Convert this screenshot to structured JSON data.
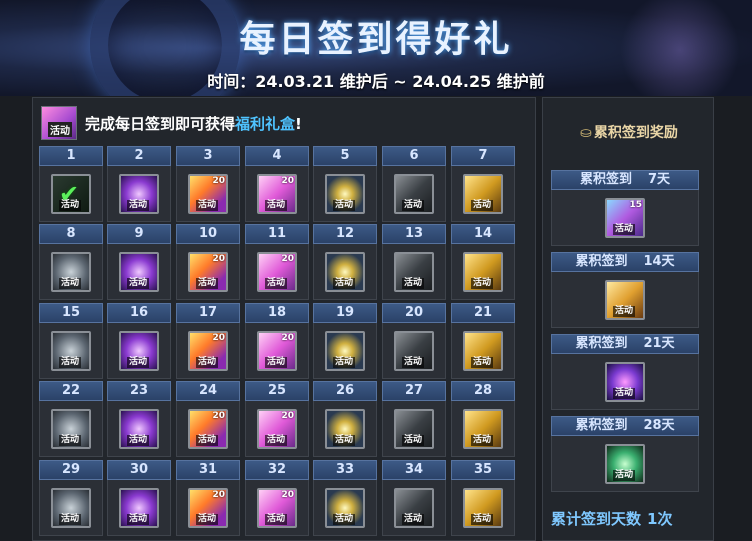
{
  "banner": {
    "title": "每日签到得好礼",
    "subtitle": "时间：24.03.21 维护后 ~ 24.04.25 维护前"
  },
  "intro": {
    "prefix": "完成每日签到即可获得",
    "highlight": "福利礼盒",
    "suffix": "!",
    "gift_badge": "活动"
  },
  "days": [
    {
      "day": "1",
      "qty": "",
      "checked": true
    },
    {
      "day": "2",
      "qty": ""
    },
    {
      "day": "3",
      "qty": "20"
    },
    {
      "day": "4",
      "qty": "20"
    },
    {
      "day": "5",
      "qty": ""
    },
    {
      "day": "6",
      "qty": ""
    },
    {
      "day": "7",
      "qty": ""
    },
    {
      "day": "8",
      "qty": ""
    },
    {
      "day": "9",
      "qty": ""
    },
    {
      "day": "10",
      "qty": "20"
    },
    {
      "day": "11",
      "qty": "20"
    },
    {
      "day": "12",
      "qty": ""
    },
    {
      "day": "13",
      "qty": ""
    },
    {
      "day": "14",
      "qty": ""
    },
    {
      "day": "15",
      "qty": ""
    },
    {
      "day": "16",
      "qty": ""
    },
    {
      "day": "17",
      "qty": "20"
    },
    {
      "day": "18",
      "qty": "20"
    },
    {
      "day": "19",
      "qty": ""
    },
    {
      "day": "20",
      "qty": ""
    },
    {
      "day": "21",
      "qty": ""
    },
    {
      "day": "22",
      "qty": ""
    },
    {
      "day": "23",
      "qty": ""
    },
    {
      "day": "24",
      "qty": "20"
    },
    {
      "day": "25",
      "qty": "20"
    },
    {
      "day": "26",
      "qty": ""
    },
    {
      "day": "27",
      "qty": ""
    },
    {
      "day": "28",
      "qty": ""
    },
    {
      "day": "29",
      "qty": ""
    },
    {
      "day": "30",
      "qty": ""
    },
    {
      "day": "31",
      "qty": "20"
    },
    {
      "day": "32",
      "qty": "20"
    },
    {
      "day": "33",
      "qty": ""
    },
    {
      "day": "34",
      "qty": ""
    },
    {
      "day": "35",
      "qty": ""
    }
  ],
  "item_badge": "活动",
  "cumulative": {
    "heading": "累积签到奖励",
    "rewards": [
      {
        "label": "累积签到",
        "days": "7天",
        "qty": "15"
      },
      {
        "label": "累积签到",
        "days": "14天",
        "qty": ""
      },
      {
        "label": "累积签到",
        "days": "21天",
        "qty": ""
      },
      {
        "label": "累积签到",
        "days": "28天",
        "qty": ""
      }
    ],
    "total_label": "累计签到天数",
    "total_value": "1次"
  }
}
